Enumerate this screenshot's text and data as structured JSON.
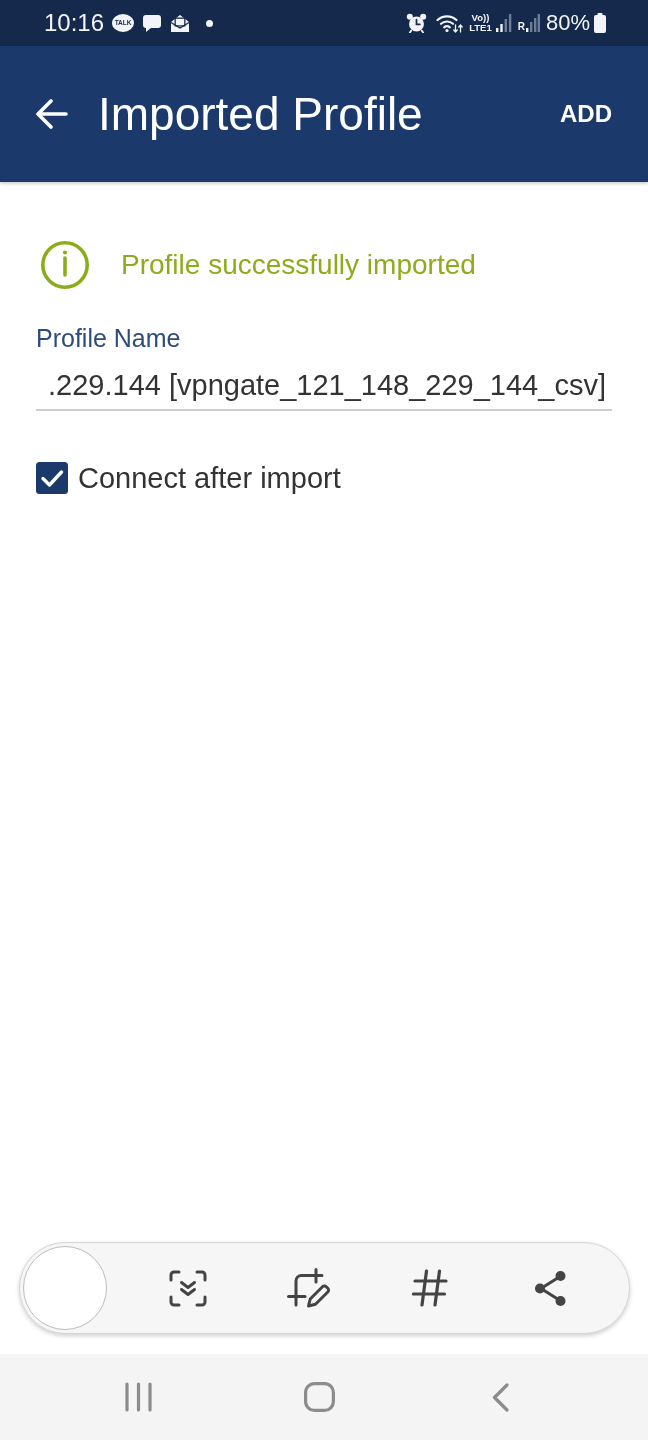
{
  "status_bar": {
    "time": "10:16",
    "chat_badge": "TALK",
    "volte": "Vo))",
    "network": "LTE1",
    "roaming": "R",
    "battery": "80%"
  },
  "app_bar": {
    "title": "Imported Profile",
    "action": "ADD"
  },
  "message": {
    "text": "Profile successfully imported"
  },
  "profile_name": {
    "label": "Profile Name",
    "value": ".229.144 [vpngate_121_148_229_144_csv]"
  },
  "connect_after_import": {
    "label": "Connect after import",
    "checked": true
  }
}
